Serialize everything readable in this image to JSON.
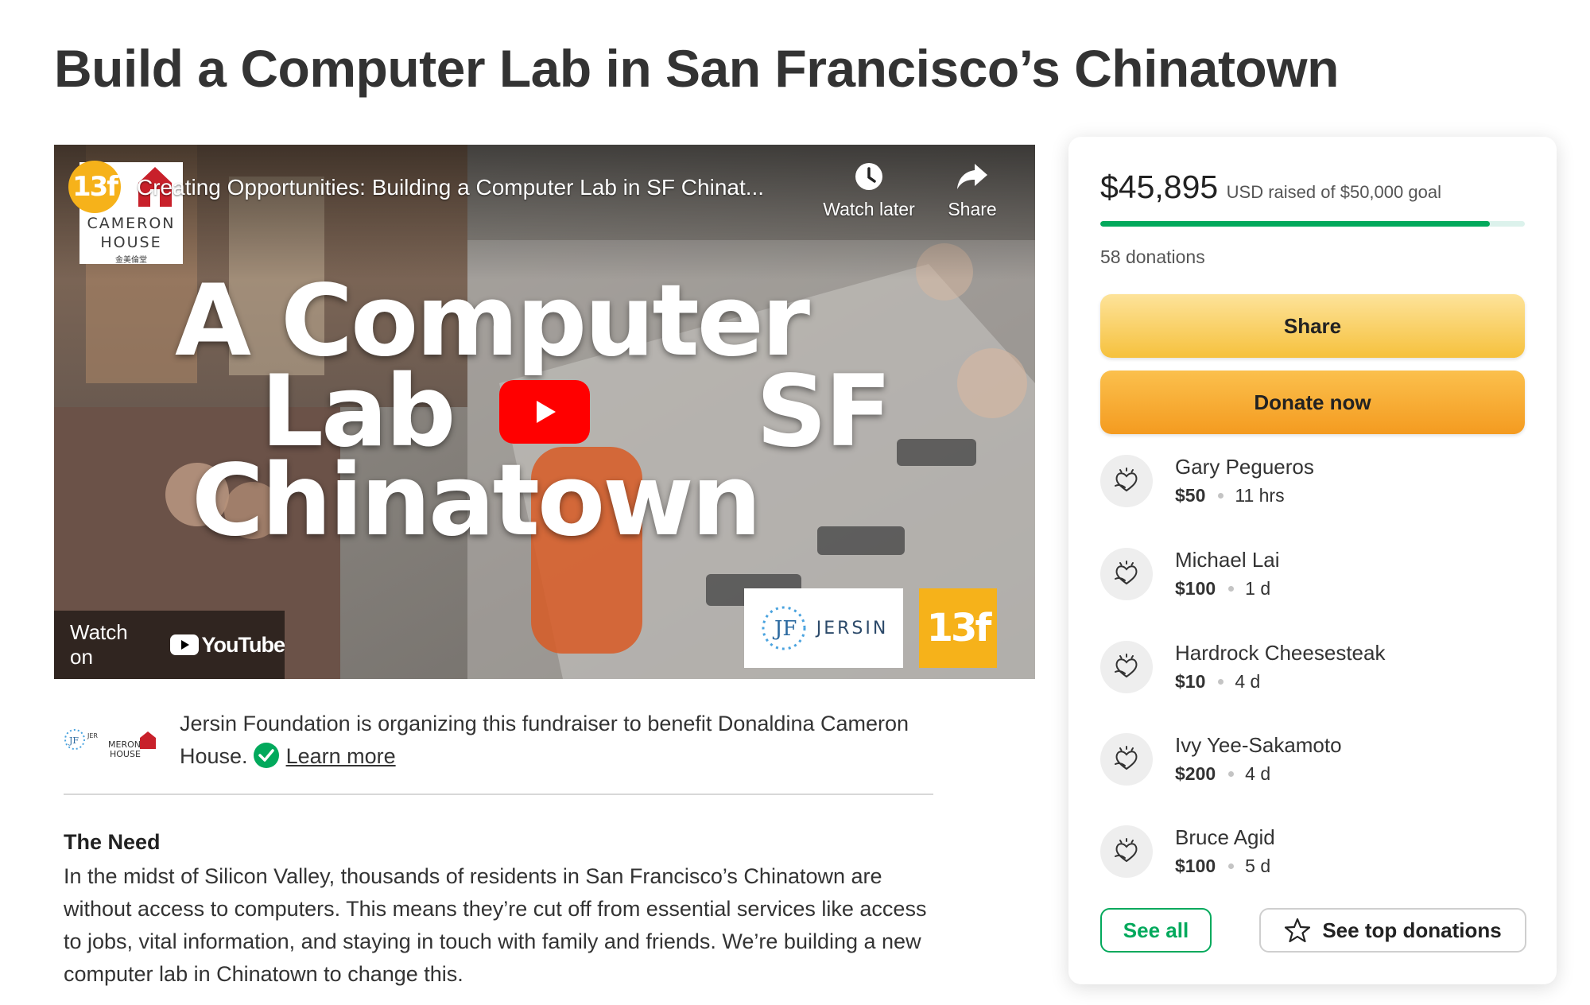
{
  "page": {
    "title": "Build a Computer Lab in San Francisco’s Chinatown"
  },
  "video": {
    "channel_badge": "13f",
    "logo_lines": [
      "CAMERON",
      "HOUSE",
      "金美倫堂"
    ],
    "title": "Creating Opportunities: Building a Computer Lab in SF Chinat...",
    "watch_later_label": "Watch later",
    "share_label": "Share",
    "overlay_line1": "A Computer",
    "overlay_line2": "Lab",
    "overlay_sf": "SF",
    "overlay_line3": "Chinatown",
    "watch_on_label": "Watch on",
    "youtube_label": "YouTube",
    "jersin_badge": "JERSIN",
    "badge_13f": "13f",
    "play_color": "#ff0000"
  },
  "organizer": {
    "text": "Jersin Foundation is organizing this fundraiser to benefit Donaldina Cameron House.",
    "learn_more": "Learn more"
  },
  "story": {
    "heading": "The Need",
    "body": "In the midst of Silicon Valley, thousands of residents in San Francisco’s Chinatown are without access to computers. This means they’re cut off from essential services like access to jobs, vital information, and staying in touch with family and friends. We’re building a new computer lab in Chinatown to change this."
  },
  "donation_card": {
    "raised_amount": "$45,895",
    "raised_label": "USD raised of $50,000 goal",
    "progress_fraction": 0.918,
    "donation_count": "58 donations",
    "share_button": "Share",
    "donate_button": "Donate now",
    "donors": [
      {
        "name": "Gary Pegueros",
        "amount": "$50",
        "time": "11 hrs"
      },
      {
        "name": "Michael Lai",
        "amount": "$100",
        "time": "1 d"
      },
      {
        "name": "Hardrock Cheesesteak",
        "amount": "$10",
        "time": "4 d"
      },
      {
        "name": "Ivy Yee-Sakamoto",
        "amount": "$200",
        "time": "4 d"
      },
      {
        "name": "Bruce Agid",
        "amount": "$100",
        "time": "5 d"
      }
    ],
    "see_all": "See all",
    "see_top": "See top donations"
  },
  "colors": {
    "accent_green": "#02a95c",
    "share_yellow": "#f6c13d",
    "donate_orange": "#f49b20",
    "brand_yellow": "#f6b21a"
  },
  "icons": [
    "clock-icon",
    "share-arrow-icon",
    "play-icon",
    "youtube-icon",
    "verified-check-icon",
    "donor-heart-icon",
    "star-icon"
  ]
}
